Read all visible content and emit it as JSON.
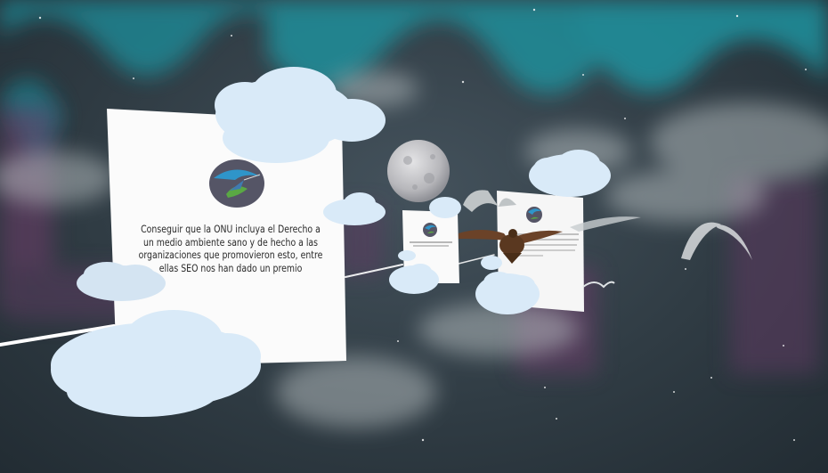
{
  "panels": {
    "main": {
      "message": "Conseguir que la ONU incluya el Derecho a un medio ambiente sano y de hecho a las organizaciones que promovieron esto, entre ellas SEO nos han dado un premio",
      "logo_icon": "hummingbird-logo-icon"
    },
    "center": {
      "logo_icon": "hummingbird-logo-icon"
    },
    "right": {
      "logo_icon": "hummingbird-logo-icon"
    }
  },
  "scene": {
    "sky_color": "#303c44",
    "aurora_color": "#1f9aa6",
    "cloud_color": "#d9eaf8",
    "moon_icon": "moon-icon",
    "bird_icon": "eagle-icon"
  }
}
